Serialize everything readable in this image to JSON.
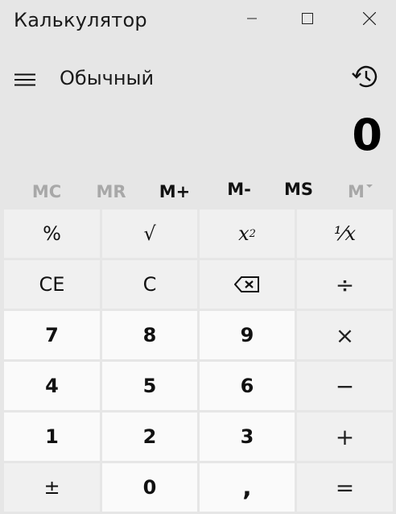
{
  "window": {
    "title": "Калькулятор",
    "minimize_icon": "minimize-icon",
    "maximize_icon": "maximize-icon",
    "close_icon": "close-icon"
  },
  "header": {
    "menu_icon": "hamburger-menu-icon",
    "mode_label": "Обычный",
    "history_icon": "history-icon"
  },
  "display": {
    "value": "0"
  },
  "memory": {
    "mc": "MC",
    "mr": "MR",
    "m_plus": "M+",
    "m_minus": "M-",
    "ms": "MS",
    "m_list": "M"
  },
  "keys": {
    "percent": "%",
    "sqrt": "√",
    "square_base": "x",
    "square_exp": "2",
    "reciprocal": "¹⁄x",
    "ce": "CE",
    "c": "C",
    "backspace_icon": "backspace-icon",
    "divide": "÷",
    "seven": "7",
    "eight": "8",
    "nine": "9",
    "multiply": "×",
    "four": "4",
    "five": "5",
    "six": "6",
    "minus": "−",
    "one": "1",
    "two": "2",
    "three": "3",
    "plus": "+",
    "negate": "±",
    "zero": "0",
    "decimal": ",",
    "equals": "="
  },
  "colors": {
    "background": "#e6e6e6",
    "function_key": "#f0f0f0",
    "number_key": "#fafafa",
    "disabled_text": "#a8a8a8"
  }
}
